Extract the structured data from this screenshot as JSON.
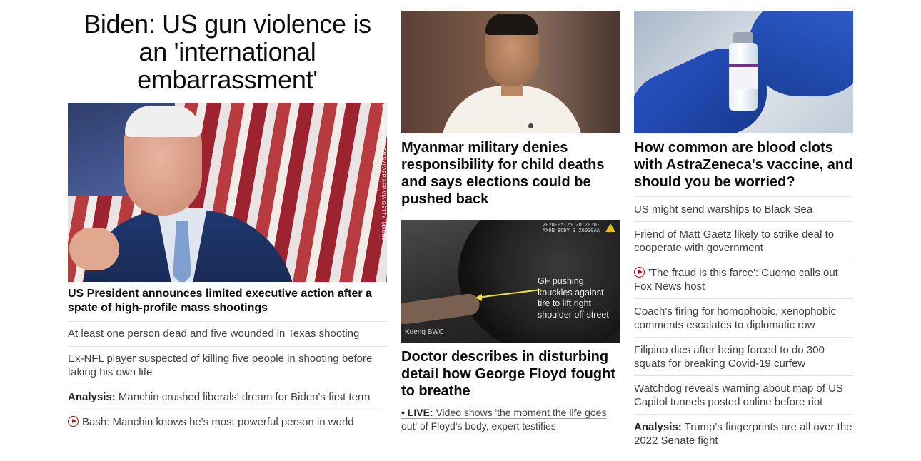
{
  "lead": {
    "headline": "Biden: US gun violence is an 'international embarrassment'",
    "image_credit": "BRENDAN SMIALOWSKI/AFP/AFP VIA GETTY IMAGES",
    "subhead": "US President announces limited executive action after a spate of high-profile mass shootings",
    "related": [
      {
        "prefix": "",
        "text": "At least one person dead and five wounded in Texas shooting",
        "video": false
      },
      {
        "prefix": "",
        "text": "Ex-NFL player suspected of killing five people in shooting before taking his own life",
        "video": false
      },
      {
        "prefix": "Analysis:",
        "text": "Manchin crushed liberals' dream for Biden's first term",
        "video": false
      },
      {
        "prefix": "",
        "text": "Bash: Manchin knows he's most powerful person in world",
        "video": true
      }
    ]
  },
  "middle": {
    "story1": {
      "headline": "Myanmar military denies responsibility for child deaths and says elections could be pushed back"
    },
    "story2": {
      "image_overlay": [
        "GF pushing",
        "knuckles against",
        "tire to lift right",
        "shoulder off street"
      ],
      "image_cam": "Kueng BWC",
      "image_timestamp": [
        "2020-05-25 20:20:0-",
        "AXON BODY 3 X6039AA"
      ],
      "headline": "Doctor describes in disturbing detail how George Floyd fought to breathe",
      "live_label": "• LIVE:",
      "live_text": "Video shows 'the moment the life goes out' of Floyd's body, expert testifies"
    }
  },
  "right": {
    "headline": "How common are blood clots with AstraZeneca's vaccine, and should you be worried?",
    "list": [
      {
        "prefix": "",
        "text": "US might send warships to Black Sea",
        "video": false
      },
      {
        "prefix": "",
        "text": "Friend of Matt Gaetz likely to strike deal to cooperate with government",
        "video": false
      },
      {
        "prefix": "",
        "text": "'The fraud is this farce': Cuomo calls out Fox News host",
        "video": true
      },
      {
        "prefix": "",
        "text": "Coach's firing for homophobic, xenophobic comments escalates to diplomatic row",
        "video": false
      },
      {
        "prefix": "",
        "text": "Filipino dies after being forced to do 300 squats for breaking Covid-19 curfew",
        "video": false
      },
      {
        "prefix": "",
        "text": "Watchdog reveals warning about map of US Capitol tunnels posted online before riot",
        "video": false
      },
      {
        "prefix": "Analysis:",
        "text": "Trump's fingerprints are all over the 2022 Senate fight",
        "video": false
      }
    ]
  },
  "colors": {
    "video_red": "#cc0000",
    "text": "#262626",
    "divider": "#e6e6e6"
  }
}
